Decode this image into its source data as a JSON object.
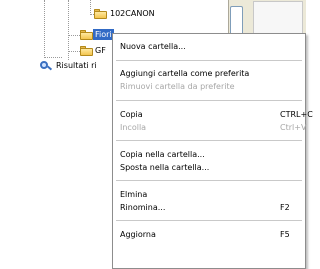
{
  "tree": {
    "nodes": [
      {
        "label": "102CANON",
        "selected": false
      },
      {
        "label": "Fiori",
        "selected": true
      },
      {
        "label": "GF",
        "selected": false
      },
      {
        "label": "Risultati ri",
        "selected": false
      }
    ]
  },
  "context_menu": {
    "items": [
      {
        "label": "Nuova cartella...",
        "shortcut": "",
        "disabled": false
      },
      {
        "label": "Aggiungi cartella come preferita",
        "shortcut": "",
        "disabled": false
      },
      {
        "label": "Rimuovi cartella da preferite",
        "shortcut": "",
        "disabled": true
      },
      {
        "label": "Copia",
        "shortcut": "CTRL+C",
        "disabled": false
      },
      {
        "label": "Incolla",
        "shortcut": "Ctrl+V",
        "disabled": true
      },
      {
        "label": "Copia nella cartella...",
        "shortcut": "",
        "disabled": false
      },
      {
        "label": "Sposta nella cartella...",
        "shortcut": "",
        "disabled": false
      },
      {
        "label": "Elmina",
        "shortcut": "",
        "disabled": false
      },
      {
        "label": "Rinomina...",
        "shortcut": "F2",
        "disabled": false
      },
      {
        "label": "Aggiorna",
        "shortcut": "F5",
        "disabled": false
      }
    ]
  },
  "colors": {
    "selection": "#316ac5",
    "disabled_text": "#a7a7a7",
    "folder": "#f3c54f"
  }
}
